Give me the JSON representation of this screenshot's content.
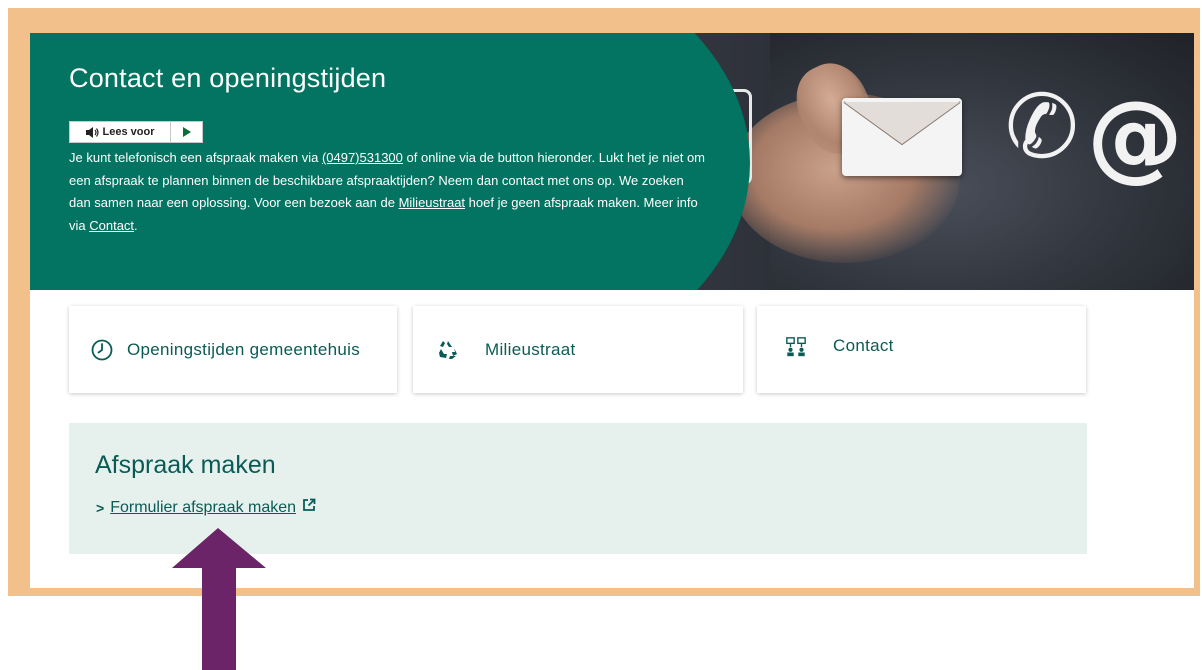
{
  "hero": {
    "title": "Contact en openingstijden",
    "readspeaker_label": "Lees voor",
    "text_1": "Je kunt telefonisch een afspraak maken via ",
    "phone": "(0497)531300",
    "text_2": " of online via de button hieronder. Lukt het je niet om een afspraak te plannen binnen de beschikbare afspraaktijden? Neem dan contact met ons op. We zoeken dan samen naar een oplossing. Voor een bezoek aan de ",
    "link_milieustraat": "Milieustraat",
    "text_3": " hoef je geen afspraak maken. Meer info via ",
    "link_contact": "Contact",
    "text_4": "."
  },
  "tiles": [
    {
      "label": "Openingstijden gemeentehuis",
      "icon": "clock-icon"
    },
    {
      "label": "Milieustraat",
      "icon": "recycle-icon"
    },
    {
      "label": "Contact",
      "icon": "network-icon"
    }
  ],
  "appointment": {
    "title": "Afspraak maken",
    "link_label": "Formulier afspraak maken",
    "link_icon": "external-link-icon"
  },
  "colors": {
    "brand_green": "#027461",
    "text_green": "#0a5b55",
    "frame": "#f2c08a",
    "arrow": "#6b2468",
    "panel_bg": "#e6f1ee"
  },
  "hero_image_glyphs": {
    "phone": "✆",
    "at": "@"
  }
}
